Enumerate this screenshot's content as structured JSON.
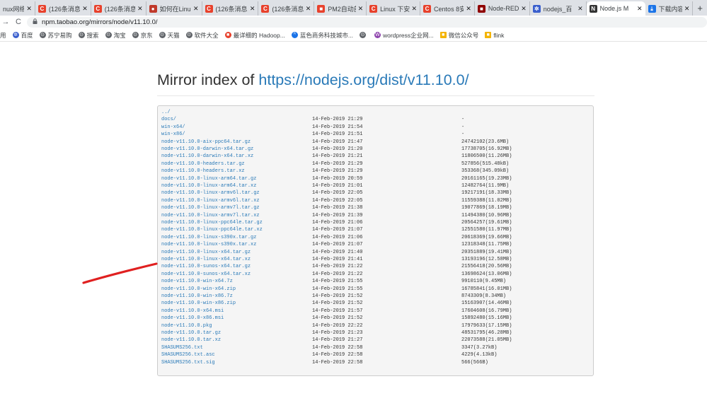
{
  "browser": {
    "tabs": [
      {
        "title": "nux网络配",
        "favicon_text": "",
        "favicon_color": "#dee1e6",
        "active": false
      },
      {
        "title": "(126条消息",
        "favicon_text": "C",
        "favicon_color": "#e8412c",
        "active": false
      },
      {
        "title": "(126条消息",
        "favicon_text": "C",
        "favicon_color": "#e8412c",
        "active": false
      },
      {
        "title": "如何在Linu",
        "favicon_text": "●",
        "favicon_color": "#c0392b",
        "active": false
      },
      {
        "title": "(126条消息",
        "favicon_text": "C",
        "favicon_color": "#e8412c",
        "active": false
      },
      {
        "title": "(126条消息",
        "favicon_text": "C",
        "favicon_color": "#e8412c",
        "active": false
      },
      {
        "title": "PM2自动部",
        "favicon_text": "■",
        "favicon_color": "#e8412c",
        "active": false
      },
      {
        "title": "Linux 下安",
        "favicon_text": "C",
        "favicon_color": "#e8412c",
        "active": false
      },
      {
        "title": "Centos 8安",
        "favicon_text": "C",
        "favicon_color": "#e8412c",
        "active": false
      },
      {
        "title": "Node-RED",
        "favicon_text": "■",
        "favicon_color": "#8f0000",
        "active": false
      },
      {
        "title": "nodejs_百",
        "favicon_text": "✲",
        "favicon_color": "#3a5fcd",
        "active": false
      },
      {
        "title": "Node.js M",
        "favicon_text": "N",
        "favicon_color": "#333333",
        "active": true
      },
      {
        "title": "下载内容",
        "favicon_text": "⤓",
        "favicon_color": "#1a73e8",
        "active": false
      }
    ],
    "new_tab_label": "+",
    "close_label": "✕",
    "back_label": "→",
    "reload_label": "C",
    "lock_label": "🔒",
    "url": "npm.taobao.org/mirrors/node/v11.10.0/",
    "bookmarks": [
      {
        "label": "用",
        "icon": ""
      },
      {
        "label": "百度",
        "icon": "✲"
      },
      {
        "label": "苏宁易购",
        "icon": "⊙"
      },
      {
        "label": "搜索",
        "icon": "⊙"
      },
      {
        "label": "淘宝",
        "icon": "⊙"
      },
      {
        "label": "京东",
        "icon": "⊙"
      },
      {
        "label": "天猫",
        "icon": "⊙"
      },
      {
        "label": "软件大全",
        "icon": "⊙"
      },
      {
        "label": "最详细的 Hadoop...",
        "icon": "■"
      },
      {
        "label": "蓝色商务科技城市...",
        "icon": "^"
      },
      {
        "label": "",
        "icon": "⊙"
      },
      {
        "label": "wordpress企业网...",
        "icon": "W"
      },
      {
        "label": "微信公众号",
        "icon": "■"
      },
      {
        "label": "flink",
        "icon": "■"
      }
    ]
  },
  "page": {
    "heading_prefix": "Mirror index of",
    "heading_link": "https://nodejs.org/dist/v11.10.0/",
    "link_color": "#2a7ab8",
    "annotation_color": "#e02020",
    "rows": [
      {
        "name": "../",
        "date": "",
        "size": ""
      },
      {
        "name": "docs/",
        "date": "14-Feb-2019 21:29",
        "size": "-"
      },
      {
        "name": "win-x64/",
        "date": "14-Feb-2019 21:54",
        "size": "-"
      },
      {
        "name": "win-x86/",
        "date": "14-Feb-2019 21:51",
        "size": "-"
      },
      {
        "name": "node-v11.10.0-aix-ppc64.tar.gz",
        "date": "14-Feb-2019 21:47",
        "size": "24742102(23.6MB)"
      },
      {
        "name": "node-v11.10.0-darwin-x64.tar.gz",
        "date": "14-Feb-2019 21:20",
        "size": "17738705(16.92MB)"
      },
      {
        "name": "node-v11.10.0-darwin-x64.tar.xz",
        "date": "14-Feb-2019 21:21",
        "size": "11806500(11.26MB)"
      },
      {
        "name": "node-v11.10.0-headers.tar.gz",
        "date": "14-Feb-2019 21:29",
        "size": "527856(515.48kB)"
      },
      {
        "name": "node-v11.10.0-headers.tar.xz",
        "date": "14-Feb-2019 21:29",
        "size": "353368(345.09kB)"
      },
      {
        "name": "node-v11.10.0-linux-arm64.tar.gz",
        "date": "14-Feb-2019 20:59",
        "size": "20161165(19.23MB)"
      },
      {
        "name": "node-v11.10.0-linux-arm64.tar.xz",
        "date": "14-Feb-2019 21:01",
        "size": "12482764(11.9MB)"
      },
      {
        "name": "node-v11.10.0-linux-armv6l.tar.gz",
        "date": "14-Feb-2019 22:05",
        "size": "19217191(18.33MB)"
      },
      {
        "name": "node-v11.10.0-linux-armv6l.tar.xz",
        "date": "14-Feb-2019 22:05",
        "size": "11559388(11.02MB)"
      },
      {
        "name": "node-v11.10.0-linux-armv7l.tar.gz",
        "date": "14-Feb-2019 21:38",
        "size": "19077869(18.19MB)"
      },
      {
        "name": "node-v11.10.0-linux-armv7l.tar.xz",
        "date": "14-Feb-2019 21:39",
        "size": "11494380(10.96MB)"
      },
      {
        "name": "node-v11.10.0-linux-ppc64le.tar.gz",
        "date": "14-Feb-2019 21:06",
        "size": "20564257(19.61MB)"
      },
      {
        "name": "node-v11.10.0-linux-ppc64le.tar.xz",
        "date": "14-Feb-2019 21:07",
        "size": "12551580(11.97MB)"
      },
      {
        "name": "node-v11.10.0-linux-s390x.tar.gz",
        "date": "14-Feb-2019 21:06",
        "size": "20618369(19.66MB)"
      },
      {
        "name": "node-v11.10.0-linux-s390x.tar.xz",
        "date": "14-Feb-2019 21:07",
        "size": "12318348(11.75MB)"
      },
      {
        "name": "node-v11.10.0-linux-x64.tar.gz",
        "date": "14-Feb-2019 21:40",
        "size": "20351889(19.41MB)"
      },
      {
        "name": "node-v11.10.0-linux-x64.tar.xz",
        "date": "14-Feb-2019 21:41",
        "size": "13193196(12.58MB)"
      },
      {
        "name": "node-v11.10.0-sunos-x64.tar.gz",
        "date": "14-Feb-2019 21:22",
        "size": "21556418(20.56MB)"
      },
      {
        "name": "node-v11.10.0-sunos-x64.tar.xz",
        "date": "14-Feb-2019 21:22",
        "size": "13698624(13.06MB)"
      },
      {
        "name": "node-v11.10.0-win-x64.7z",
        "date": "14-Feb-2019 21:55",
        "size": "9910110(9.45MB)"
      },
      {
        "name": "node-v11.10.0-win-x64.zip",
        "date": "14-Feb-2019 21:55",
        "size": "16785841(16.01MB)"
      },
      {
        "name": "node-v11.10.0-win-x86.7z",
        "date": "14-Feb-2019 21:52",
        "size": "8743309(8.34MB)"
      },
      {
        "name": "node-v11.10.0-win-x86.zip",
        "date": "14-Feb-2019 21:52",
        "size": "15163907(14.46MB)"
      },
      {
        "name": "node-v11.10.0-x64.msi",
        "date": "14-Feb-2019 21:57",
        "size": "17604608(16.79MB)"
      },
      {
        "name": "node-v11.10.0-x86.msi",
        "date": "14-Feb-2019 21:52",
        "size": "15892480(15.16MB)"
      },
      {
        "name": "node-v11.10.0.pkg",
        "date": "14-Feb-2019 22:22",
        "size": "17979633(17.15MB)"
      },
      {
        "name": "node-v11.10.0.tar.gz",
        "date": "14-Feb-2019 21:23",
        "size": "48531795(46.28MB)"
      },
      {
        "name": "node-v11.10.0.tar.xz",
        "date": "14-Feb-2019 21:27",
        "size": "22073588(21.05MB)"
      },
      {
        "name": "SHASUMS256.txt",
        "date": "14-Feb-2019 22:58",
        "size": "3347(3.27kB)"
      },
      {
        "name": "SHASUMS256.txt.asc",
        "date": "14-Feb-2019 22:58",
        "size": "4229(4.13kB)"
      },
      {
        "name": "SHASUMS256.txt.sig",
        "date": "14-Feb-2019 22:58",
        "size": "566(566B)"
      }
    ]
  }
}
